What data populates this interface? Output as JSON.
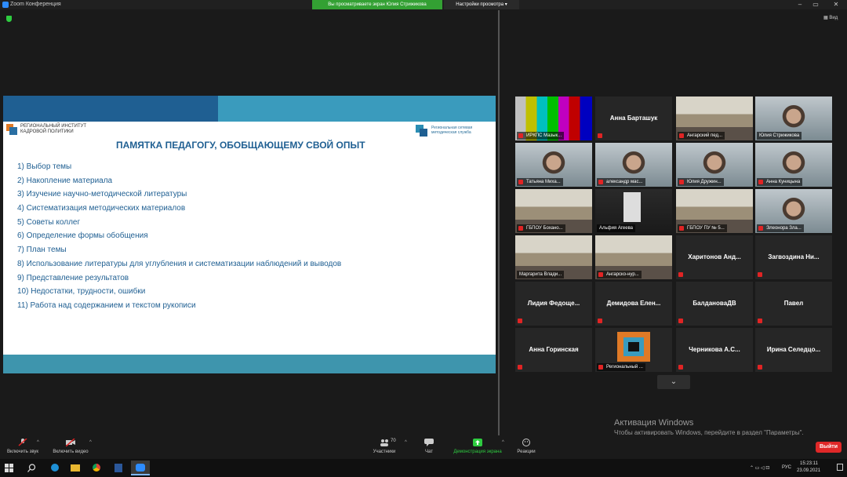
{
  "window": {
    "title": "Zoom Конференция",
    "share_banner": "Вы просматриваете экран Юлия Стрижикова",
    "view_options": "Настройки просмотра",
    "view_label": "Вид"
  },
  "slide": {
    "institute": [
      "РЕГИОНАЛЬНЫЙ ИНСТИТУТ",
      "КАДРОВОЙ ПОЛИТИКИ"
    ],
    "service": [
      "Региональная сетевая",
      "методическая служба"
    ],
    "title": "ПАМЯТКА ПЕДАГОГУ, ОБОБЩАЮЩЕМУ СВОЙ ОПЫТ",
    "points": [
      "1)  Выбор темы",
      "2)  Накопление  материала",
      "3)  Изучение научно-методической литературы",
      "4)  Систематизация методических материалов",
      "5)  Советы коллег",
      "6)  Определение формы обобщения",
      "7)  План темы",
      "8)  Использование литературы для углубления и систематизации наблюдений и выводов",
      "9)  Представление результатов",
      "10) Недостатки, трудности, ошибки",
      "11) Работа  над содержанием и текстом рукописи"
    ]
  },
  "participants": [
    {
      "name": "ИРКПС Мазык...",
      "mode": "label",
      "muted": true,
      "video": "bars"
    },
    {
      "name": "Анна Барташук",
      "mode": "center",
      "muted": true
    },
    {
      "name": "Ангарский пед...",
      "mode": "label",
      "muted": true,
      "video": "room"
    },
    {
      "name": "Юлия Стрижикова",
      "mode": "label",
      "muted": false,
      "active": true,
      "video": "face"
    },
    {
      "name": "Татьяна Миха...",
      "mode": "label",
      "muted": true,
      "video": "face"
    },
    {
      "name": "александр мас...",
      "mode": "label",
      "muted": true,
      "video": "face"
    },
    {
      "name": "Юлия Дружин...",
      "mode": "label",
      "muted": true,
      "video": "face"
    },
    {
      "name": "Анна Куницына",
      "mode": "label",
      "muted": true,
      "video": "face"
    },
    {
      "name": "ГБПОУ Бохано...",
      "mode": "label",
      "muted": true,
      "video": "room"
    },
    {
      "name": "Альфия Агеева",
      "mode": "label",
      "muted": false,
      "video": "dark"
    },
    {
      "name": "ГБПОУ ПУ № 5...",
      "mode": "label",
      "muted": true,
      "video": "room"
    },
    {
      "name": "Элеонора Зла...",
      "mode": "label",
      "muted": true,
      "video": "face"
    },
    {
      "name": "Маргарита Влади...",
      "mode": "label",
      "muted": false,
      "video": "room"
    },
    {
      "name": "Ангарско-нур...",
      "mode": "label",
      "muted": true,
      "video": "room"
    },
    {
      "name": "Харитонов  Анд...",
      "mode": "center",
      "muted": true
    },
    {
      "name": "Загвоздина  Ни...",
      "mode": "center",
      "muted": true
    },
    {
      "name": "Лидия  Федоще...",
      "mode": "center",
      "muted": true
    },
    {
      "name": "Демидова  Елен...",
      "mode": "center",
      "muted": true
    },
    {
      "name": "БалдановаДВ",
      "mode": "center",
      "muted": true
    },
    {
      "name": "Павел",
      "mode": "center",
      "muted": true
    },
    {
      "name": "Анна Горинская",
      "mode": "center",
      "muted": true
    },
    {
      "name": "Региональный ...",
      "mode": "label",
      "muted": true,
      "video": "logo"
    },
    {
      "name": "Черникова  А.С...",
      "mode": "center",
      "muted": true
    },
    {
      "name": "Ирина  Селедцо...",
      "mode": "center",
      "muted": true
    }
  ],
  "activation": {
    "title": "Активация Windows",
    "subtitle": "Чтобы активировать Windows, перейдите в раздел \"Параметры\"."
  },
  "toolbar": {
    "unmute": "Включить звук",
    "start_video": "Включить видео",
    "participants_count": "70",
    "participants": "Участники",
    "chat": "Чат",
    "share": "Демонстрация экрана",
    "reactions": "Реакции",
    "leave": "Выйти"
  },
  "taskbar": {
    "language": "РУС",
    "time": "15:23:11",
    "date": "23.09.2021"
  },
  "colors": {
    "share_green": "#33a033",
    "active_speaker": "#c8e640",
    "leave_red": "#e02828",
    "slide_blue": "#1f5f92"
  }
}
